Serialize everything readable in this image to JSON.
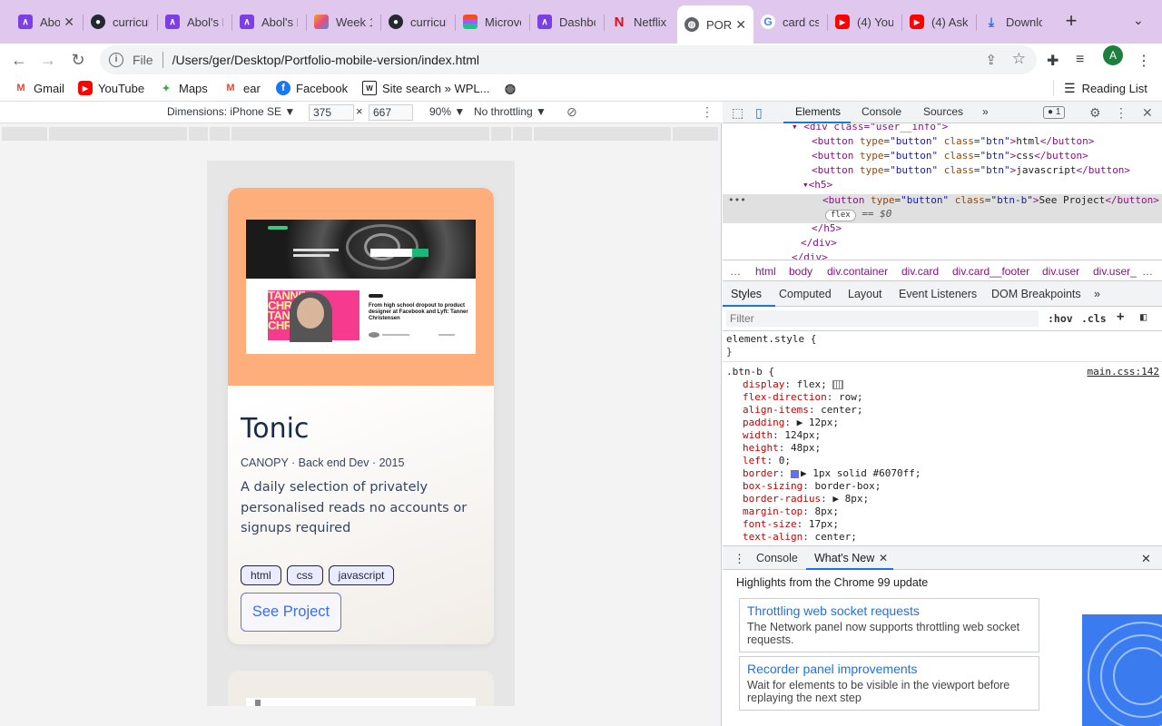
{
  "tabs": [
    {
      "label": "Abo",
      "icon": "abol-icon",
      "color": "#7b3fe4"
    },
    {
      "label": "curricul",
      "icon": "github-icon",
      "color": "#24292f"
    },
    {
      "label": "Abol's F",
      "icon": "abol-icon",
      "color": "#7b3fe4"
    },
    {
      "label": "Abol's F",
      "icon": "abol-icon",
      "color": "#7b3fe4"
    },
    {
      "label": "Week 1",
      "icon": "week-icon",
      "color": "#e94c7b"
    },
    {
      "label": "curricul",
      "icon": "github-icon",
      "color": "#24292f"
    },
    {
      "label": "Microve",
      "icon": "figma-icon",
      "color": "#f24e1e"
    },
    {
      "label": "Dashbo",
      "icon": "abol-icon",
      "color": "#7b3fe4"
    },
    {
      "label": "Netflix",
      "icon": "netflix-icon",
      "color": "#e50914"
    },
    {
      "label": "POR",
      "icon": "globe-icon",
      "color": "#5f6368"
    },
    {
      "label": "card cs",
      "icon": "google-icon",
      "color": "#4285f4"
    },
    {
      "label": "(4) You",
      "icon": "youtube-icon",
      "color": "#ff0000"
    },
    {
      "label": "(4) Ask",
      "icon": "youtube-icon",
      "color": "#ff0000"
    },
    {
      "label": "Downlo",
      "icon": "download-icon",
      "color": "#1a73e8"
    }
  ],
  "address": {
    "scheme": "File",
    "url": "/Users/ger/Desktop/Portfolio-mobile-version/index.html"
  },
  "profile_initial": "A",
  "bookmarks": [
    {
      "label": "Gmail",
      "icon": "gmail-icon",
      "color": "#ea4335"
    },
    {
      "label": "YouTube",
      "icon": "youtube-icon",
      "color": "#ff0000"
    },
    {
      "label": "Maps",
      "icon": "maps-icon",
      "color": "#34a853"
    },
    {
      "label": "ear",
      "icon": "gmail-icon",
      "color": "#ea4335"
    },
    {
      "label": "Facebook",
      "icon": "facebook-icon",
      "color": "#1877f2"
    },
    {
      "label": "Site search » WPL...",
      "icon": "wpl-icon",
      "color": "#222222"
    }
  ],
  "reading_list": "Reading List",
  "device": {
    "dimensions": "Dimensions: iPhone SE ▼",
    "width": "375",
    "height": "667",
    "zoom": "90% ▼",
    "throttle": "No throttling ▼"
  },
  "card": {
    "title": "Tonic",
    "meta": "CANOPY · Back end Dev · 2015",
    "description": "A daily selection of privately personalised reads no accounts or signups required",
    "tags": [
      "html",
      "css",
      "javascript"
    ],
    "cta": "See Project",
    "shot_headline": "From high school dropout to product designer at Facebook and Lyft: Tanner Christensen",
    "shot_name": [
      "TANNE",
      "CHRIS",
      "TANNE",
      "CHRIS"
    ]
  },
  "devtools": {
    "tabs": [
      "Elements",
      "Console",
      "Sources",
      "»"
    ],
    "issues": "1",
    "dom_lines": {
      "l0": "<div class=\"user__info\">",
      "b1_open": "<button",
      "b1_type": "type",
      "b1_typev": "\"button\"",
      "b1_class": "class",
      "b1_classv": "\"btn\"",
      "b1_text": "html",
      "b2_text": "css",
      "b3_text": "javascript",
      "h5_open": "<h5>",
      "btnb_classv": "\"btn-b\"",
      "btnb_text": "See Project",
      "flex": "flex",
      "eq": "== $0",
      "h5_close": "</h5>",
      "div_close": "</div>",
      "div_close2": "</div>"
    },
    "crumbs": [
      "html",
      "body",
      "div.container",
      "div.card",
      "div.card__footer",
      "div.user",
      "div.user_"
    ],
    "subtabs": [
      "Styles",
      "Computed",
      "Layout",
      "Event Listeners",
      "DOM Breakpoints",
      "»"
    ],
    "filter_placeholder": "Filter",
    "hov": ":hov",
    "cls": ".cls",
    "element_style": "element.style {",
    "rule_selector": ".btn-b {",
    "rule_source": "main.css:142",
    "props": [
      {
        "p": "display",
        "v": "flex;"
      },
      {
        "p": "flex-direction",
        "v": "row;"
      },
      {
        "p": "align-items",
        "v": "center;"
      },
      {
        "p": "padding",
        "v": "▶ 12px;"
      },
      {
        "p": "width",
        "v": "124px;"
      },
      {
        "p": "height",
        "v": "48px;"
      },
      {
        "p": "left",
        "v": "0;"
      },
      {
        "p": "border",
        "v": "▶ 1px solid #6070ff;"
      },
      {
        "p": "box-sizing",
        "v": "border-box;"
      },
      {
        "p": "border-radius",
        "v": "▶ 8px;"
      },
      {
        "p": "margin-top",
        "v": "8px;"
      },
      {
        "p": "font-size",
        "v": "17px;"
      },
      {
        "p": "text-align",
        "v": "center;"
      }
    ],
    "drawer_tabs": [
      "Console",
      "What's New"
    ],
    "highlights": "Highlights from the Chrome 99 update",
    "whats_new": [
      {
        "h": "Throttling web socket requests",
        "p": "The Network panel now supports throttling web socket requests."
      },
      {
        "h": "Recorder panel improvements",
        "p": "Wait for elements to be visible in the viewport before replaying the next step"
      }
    ]
  }
}
